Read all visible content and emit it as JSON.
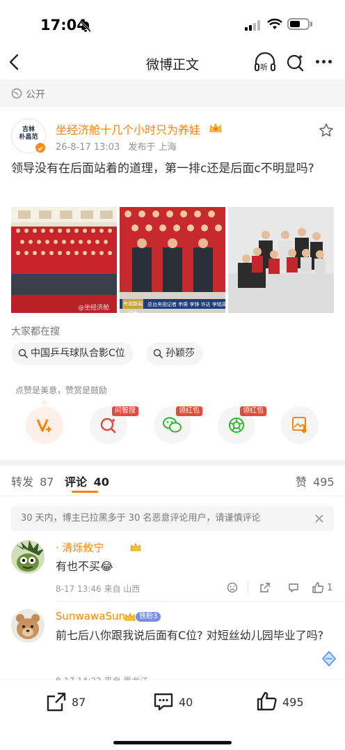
{
  "status": {
    "time": "17:04"
  },
  "nav": {
    "title": "微博正文"
  },
  "visibility": {
    "label": "公开"
  },
  "post": {
    "avatar_text_1": "吉林",
    "avatar_text_2": "朴昌范",
    "username": "坐经济舱十几个小时只为养娃",
    "timestamp": "26-8-17 13:03",
    "location": "发布于 上海",
    "text": "领导没有在后面站着的道理，第一排c还是后面c不明显吗?",
    "photo1_watermark": "@坐经济舱",
    "photo2_watermark": "央视新闻记者"
  },
  "search": {
    "title": "大家都在搜",
    "chips": [
      "中国乒乓球队合影C位",
      "孙颖莎"
    ]
  },
  "reward": {
    "tip": "点赞是美意，赞赏是鼓励",
    "badges": [
      "问智搜",
      "领红包",
      "领红包"
    ]
  },
  "tabs": {
    "repost_label": "转发",
    "repost_count": "87",
    "comment_label": "评论",
    "comment_count": "40",
    "like_label": "赞",
    "like_count": "495"
  },
  "notice": "30 天内，博主已拉黑多于 30 名恶意评论用户，请谨慎评论",
  "comments": [
    {
      "name": "· 清烁攸宁",
      "text": "有也不买😂",
      "meta": "8-17 13:46  来自 山西",
      "likes": "1"
    },
    {
      "name": "SunwawaSun",
      "fan_badge": "铁粉3",
      "text": "前七后八你跟我说后面有C位? 对短丝幼儿园毕业了吗?",
      "meta": "8-17 14:22  来自 黑龙江"
    }
  ],
  "bottom": {
    "repost": "87",
    "comment": "40",
    "like": "495"
  },
  "colors": {
    "accent": "#ff8200",
    "badge_red": "#e8473b"
  }
}
